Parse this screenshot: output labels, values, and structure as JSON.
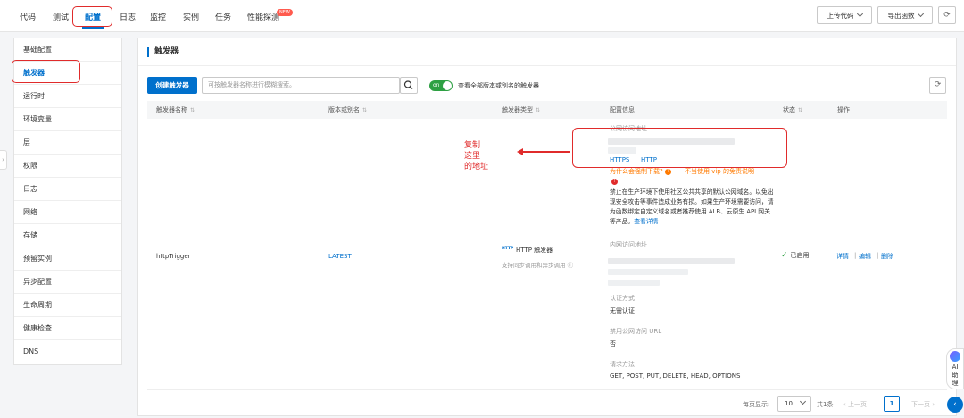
{
  "tabs": [
    {
      "label": "代码"
    },
    {
      "label": "测试"
    },
    {
      "label": "配置"
    },
    {
      "label": "日志"
    },
    {
      "label": "监控"
    },
    {
      "label": "实例"
    },
    {
      "label": "任务"
    },
    {
      "label": "性能探测",
      "badge": "NEW"
    }
  ],
  "toolbar": {
    "upload_label": "上传代码",
    "export_label": "导出函数",
    "refresh_icon": "refresh-icon"
  },
  "sidebar": {
    "items": [
      {
        "label": "基础配置"
      },
      {
        "label": "触发器"
      },
      {
        "label": "运行时"
      },
      {
        "label": "环境变量"
      },
      {
        "label": "层"
      },
      {
        "label": "权限"
      },
      {
        "label": "日志"
      },
      {
        "label": "网络"
      },
      {
        "label": "存储"
      },
      {
        "label": "预留实例"
      },
      {
        "label": "异步配置"
      },
      {
        "label": "生命周期"
      },
      {
        "label": "健康检查"
      },
      {
        "label": "DNS"
      }
    ],
    "active_index": 1
  },
  "main": {
    "section_title": "触发器",
    "create_button": "创建触发器",
    "search_placeholder": "可按触发器名称进行模糊搜索。",
    "toggle_state": "on",
    "toggle_label": "查看全部版本或别名的触发器",
    "columns": [
      "触发器名称",
      "版本或别名",
      "触发器类型",
      "配置信息",
      "状态",
      "操作"
    ],
    "row": {
      "name": "httpTrigger",
      "version": "LATEST",
      "type_icon_text": "HTTP",
      "type": "HTTP 触发器",
      "type_sub": "支持同步调用和异步调用",
      "public_url_label": "公网访问地址",
      "protocols": [
        "HTTPS",
        "HTTP"
      ],
      "force_download_link": "为什么会强制下载?",
      "vip_link": "不当使用 vip 的免责说明",
      "notice": "禁止在生产环境下使用社区公共共享的默认公网域名。以免出现安全攻击等事件造成业务有损。如果生产环境需要访问，请为函数绑定自定义域名或者推荐使用 ALB、云原生 API 网关等产品。",
      "notice_link": "查看详情",
      "private_url_label": "内网访问地址",
      "auth_label": "认证方式",
      "auth_value": "无需认证",
      "disable_public_label": "禁用公网访问 URL",
      "disable_public_value": "否",
      "methods_label": "请求方法",
      "methods_value": "GET, POST, PUT, DELETE, HEAD, OPTIONS",
      "status": "已启用",
      "actions": [
        "详情",
        "编辑",
        "删除"
      ]
    }
  },
  "annotation": {
    "lines": [
      "复制",
      "这里",
      "的地址"
    ],
    "color": "#e02b2b"
  },
  "pagination": {
    "page_size_label": "每页显示:",
    "page_size": "10",
    "total": "共1条",
    "prev": "上一页",
    "current": "1",
    "next": "下一页"
  },
  "ai_helper": {
    "label_1": "AI",
    "label_2": "助",
    "label_3": "理"
  },
  "colors": {
    "accent": "#0070cc",
    "annotation": "#e02b2b",
    "success": "#2ea043",
    "warning": "#ff7a00"
  }
}
